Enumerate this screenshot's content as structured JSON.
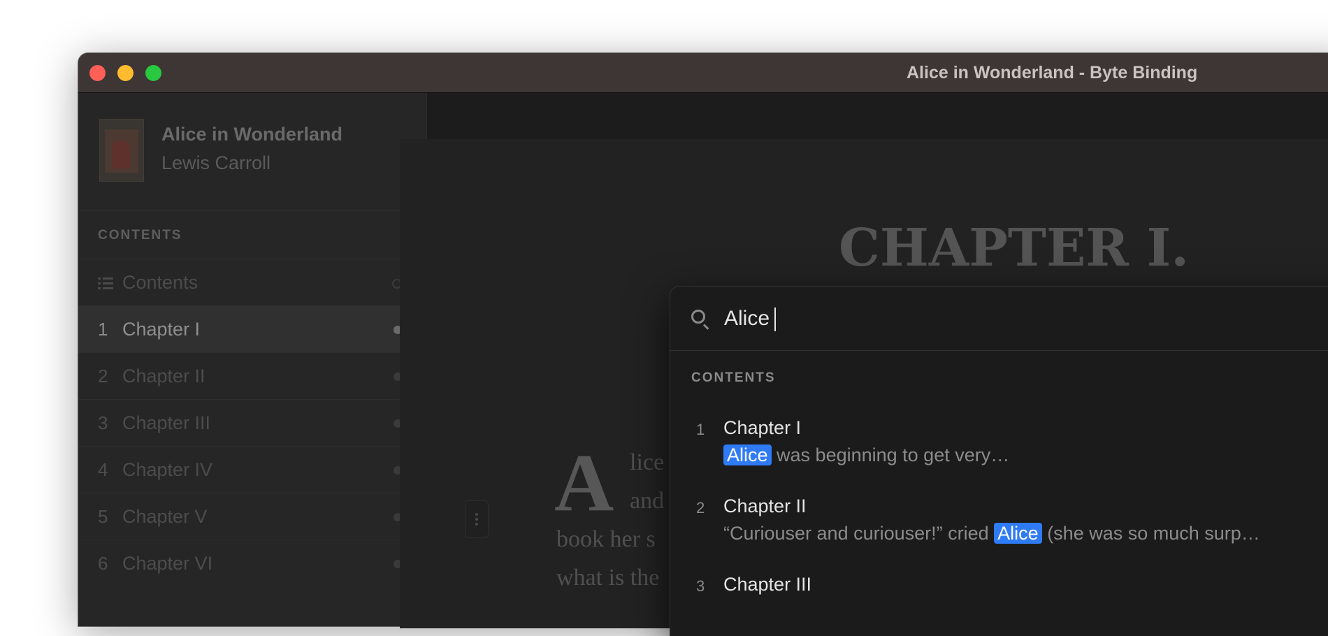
{
  "window": {
    "title": "Alice in Wonderland - Byte Binding"
  },
  "sidebar": {
    "book_title": "Alice in Wonderland",
    "book_author": "Lewis Carroll",
    "section_label": "CONTENTS",
    "items": [
      {
        "num": "",
        "label": "Contents",
        "icon": "list-icon"
      },
      {
        "num": "1",
        "label": "Chapter I",
        "active": true
      },
      {
        "num": "2",
        "label": "Chapter II"
      },
      {
        "num": "3",
        "label": "Chapter III"
      },
      {
        "num": "4",
        "label": "Chapter IV"
      },
      {
        "num": "5",
        "label": "Chapter V"
      },
      {
        "num": "6",
        "label": "Chapter VI"
      }
    ]
  },
  "reader": {
    "chapter_heading": "CHAPTER I.",
    "drop_cap": "A",
    "lines": [
      "lice",
      "and",
      "book her s",
      "what is the"
    ]
  },
  "search": {
    "query": "Alice",
    "results_label": "CONTENTS",
    "results": [
      {
        "num": "1",
        "title": "Chapter I",
        "before": "",
        "match": "Alice",
        "after": " was beginning to get very…"
      },
      {
        "num": "2",
        "title": "Chapter II",
        "before": "“Curiouser and curiouser!” cried ",
        "match": "Alice",
        "after": " (she was so much surp…"
      },
      {
        "num": "3",
        "title": "Chapter III",
        "before": "",
        "match": "",
        "after": ""
      }
    ]
  },
  "colors": {
    "titlebar": "#3e3535",
    "highlight": "#2f7bf5",
    "traffic_red": "#fe5f57",
    "traffic_yellow": "#febc2e",
    "traffic_green": "#28c840"
  }
}
